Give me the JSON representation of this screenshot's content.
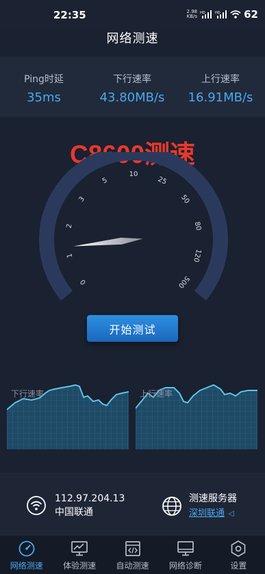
{
  "status": {
    "time": "22:35",
    "net_speed_value": "2.98",
    "net_speed_unit": "KB/s",
    "battery": "62"
  },
  "header": {
    "title": "网络测速"
  },
  "stats": [
    {
      "label": "Ping时延",
      "value": "35ms"
    },
    {
      "label": "下行速率",
      "value": "43.80MB/s"
    },
    {
      "label": "上行速率",
      "value": "16.91MB/s"
    }
  ],
  "watermark": "C8600测速",
  "gauge": {
    "ticks": [
      "0",
      "1",
      "2",
      "3",
      "5",
      "10",
      "25",
      "50",
      "80",
      "120",
      "500"
    ],
    "needle_fraction": 0.13
  },
  "start_button": "开始测试",
  "charts": {
    "download_label": "下行速率",
    "upload_label": "上行速率"
  },
  "info": {
    "ip": "112.97.204.13",
    "isp": "中国联通",
    "server_title": "测速服务器",
    "server_name": "深圳联通"
  },
  "nav": [
    {
      "label": "网络测速",
      "icon": "speedometer-icon",
      "active": true
    },
    {
      "label": "体验测速",
      "icon": "monitor-chart-icon",
      "active": false
    },
    {
      "label": "自动测速",
      "icon": "code-window-icon",
      "active": false
    },
    {
      "label": "网络诊断",
      "icon": "monitor-icon",
      "active": false
    },
    {
      "label": "设置",
      "icon": "settings-hexagon-icon",
      "active": false
    }
  ],
  "colors": {
    "accent": "#4aa8f0",
    "watermark": "#e8382c",
    "background": "#1a2130"
  }
}
